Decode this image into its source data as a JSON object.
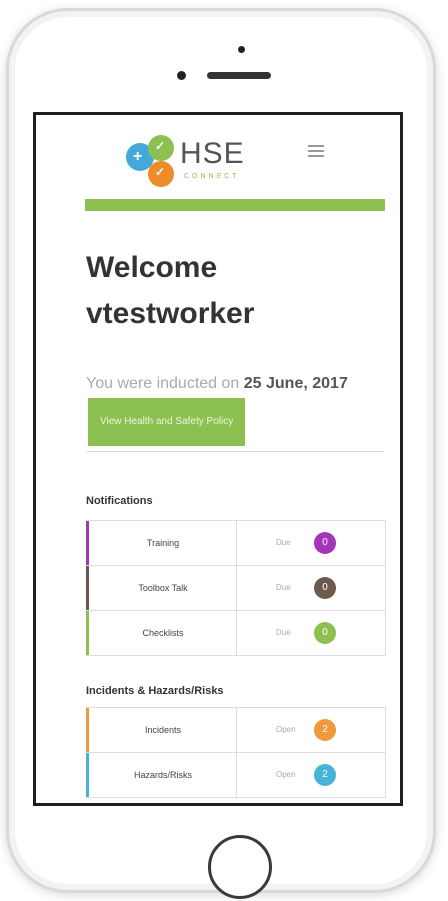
{
  "header": {
    "logo_brand": "HSE",
    "logo_sub": "CONNECT"
  },
  "welcome": {
    "title_line1": "Welcome",
    "title_line2": "vtestworker"
  },
  "induction": {
    "prefix": "You were inducted on",
    "date": "25 June, 2017",
    "button_label": "View Health and Safety Policy"
  },
  "notifications": {
    "title": "Notifications",
    "rows": [
      {
        "name": "Training",
        "status": "Due",
        "count": "0",
        "color": "#a335b8"
      },
      {
        "name": "Toolbox Talk",
        "status": "Due",
        "count": "0",
        "color": "#6d5a4c"
      },
      {
        "name": "Checklists",
        "status": "Due",
        "count": "0",
        "color": "#8cc152"
      }
    ]
  },
  "incidents": {
    "title": "Incidents & Hazards/Risks",
    "rows": [
      {
        "name": "Incidents",
        "status": "Open",
        "count": "2",
        "color": "#ee9a3a"
      },
      {
        "name": "Hazards/Risks",
        "status": "Open",
        "count": "2",
        "color": "#45b4d8"
      }
    ]
  },
  "colors": {
    "accent_green": "#8cc152"
  }
}
